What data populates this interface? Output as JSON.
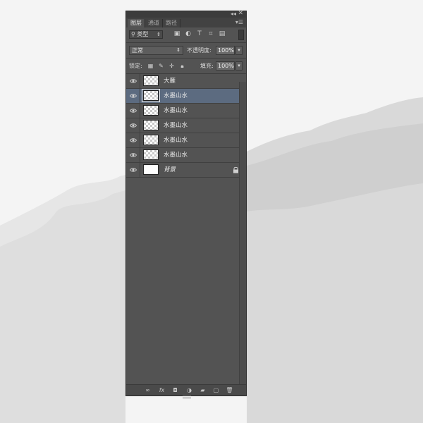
{
  "panel": {
    "tabs": [
      "图层",
      "通道",
      "路径"
    ],
    "active_tab": 0,
    "filter": {
      "kind_label": "类型"
    },
    "blend_mode": "正常",
    "opacity": {
      "label": "不透明度:",
      "value": "100%"
    },
    "lock": {
      "label": "锁定:"
    },
    "fill": {
      "label": "填充:",
      "value": "100%"
    },
    "layers": [
      {
        "name": "大雁",
        "selected": false,
        "thumb": "transparent",
        "italic": false,
        "locked": false
      },
      {
        "name": "水墨山水",
        "selected": true,
        "thumb": "transparent",
        "italic": false,
        "locked": false
      },
      {
        "name": "水墨山水",
        "selected": false,
        "thumb": "transparent",
        "italic": false,
        "locked": false
      },
      {
        "name": "水墨山水",
        "selected": false,
        "thumb": "transparent",
        "italic": false,
        "locked": false
      },
      {
        "name": "水墨山水",
        "selected": false,
        "thumb": "transparent",
        "italic": false,
        "locked": false
      },
      {
        "name": "水墨山水",
        "selected": false,
        "thumb": "transparent",
        "italic": false,
        "locked": false
      },
      {
        "name": "背景",
        "selected": false,
        "thumb": "white",
        "italic": true,
        "locked": true
      }
    ],
    "bottom_icons": [
      "link-icon",
      "fx-icon",
      "mask-icon",
      "adjustment-icon",
      "folder-icon",
      "new-layer-icon",
      "trash-icon"
    ],
    "colors": {
      "panel": "#535353",
      "selected": "#5c6b80",
      "canvas_bg": "#f4f4f4",
      "mountain": "#dcdcdc"
    }
  }
}
